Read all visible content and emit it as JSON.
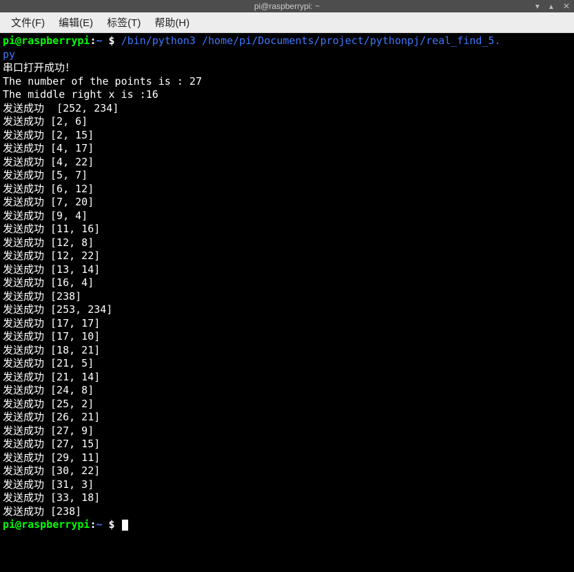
{
  "titlebar": {
    "title": "pi@raspberrypi: ~"
  },
  "menu": {
    "file": "文件(F)",
    "edit": "编辑(E)",
    "tabs": "标签(T)",
    "help": "帮助(H)"
  },
  "prompt": {
    "userhost": "pi@raspberrypi",
    "colon": ":",
    "path": "~",
    "dollar": " $ "
  },
  "command": {
    "interpreter": "/bin/python3",
    "sep": " ",
    "script": "/home/pi/Documents/project/pythonpj/real_find_5.",
    "script_cont": "py"
  },
  "output": {
    "serial_ok": "串口打开成功！",
    "points_line": "The number of the points is : 27",
    "middle_line": "The middle right x is :16",
    "send_prefix": "发送成功 ",
    "sends": [
      "[252, 234]",
      "[2, 6]",
      "[2, 15]",
      "[4, 17]",
      "[4, 22]",
      "[5, 7]",
      "[6, 12]",
      "[7, 20]",
      "[9, 4]",
      "[11, 16]",
      "[12, 8]",
      "[12, 22]",
      "[13, 14]",
      "[16, 4]",
      "[238]",
      "[253, 234]",
      "[17, 17]",
      "[17, 10]",
      "[18, 21]",
      "[21, 5]",
      "[21, 14]",
      "[24, 8]",
      "[25, 2]",
      "[26, 21]",
      "[27, 9]",
      "[27, 15]",
      "[29, 11]",
      "[30, 22]",
      "[31, 3]",
      "[33, 18]",
      "[238]"
    ]
  }
}
